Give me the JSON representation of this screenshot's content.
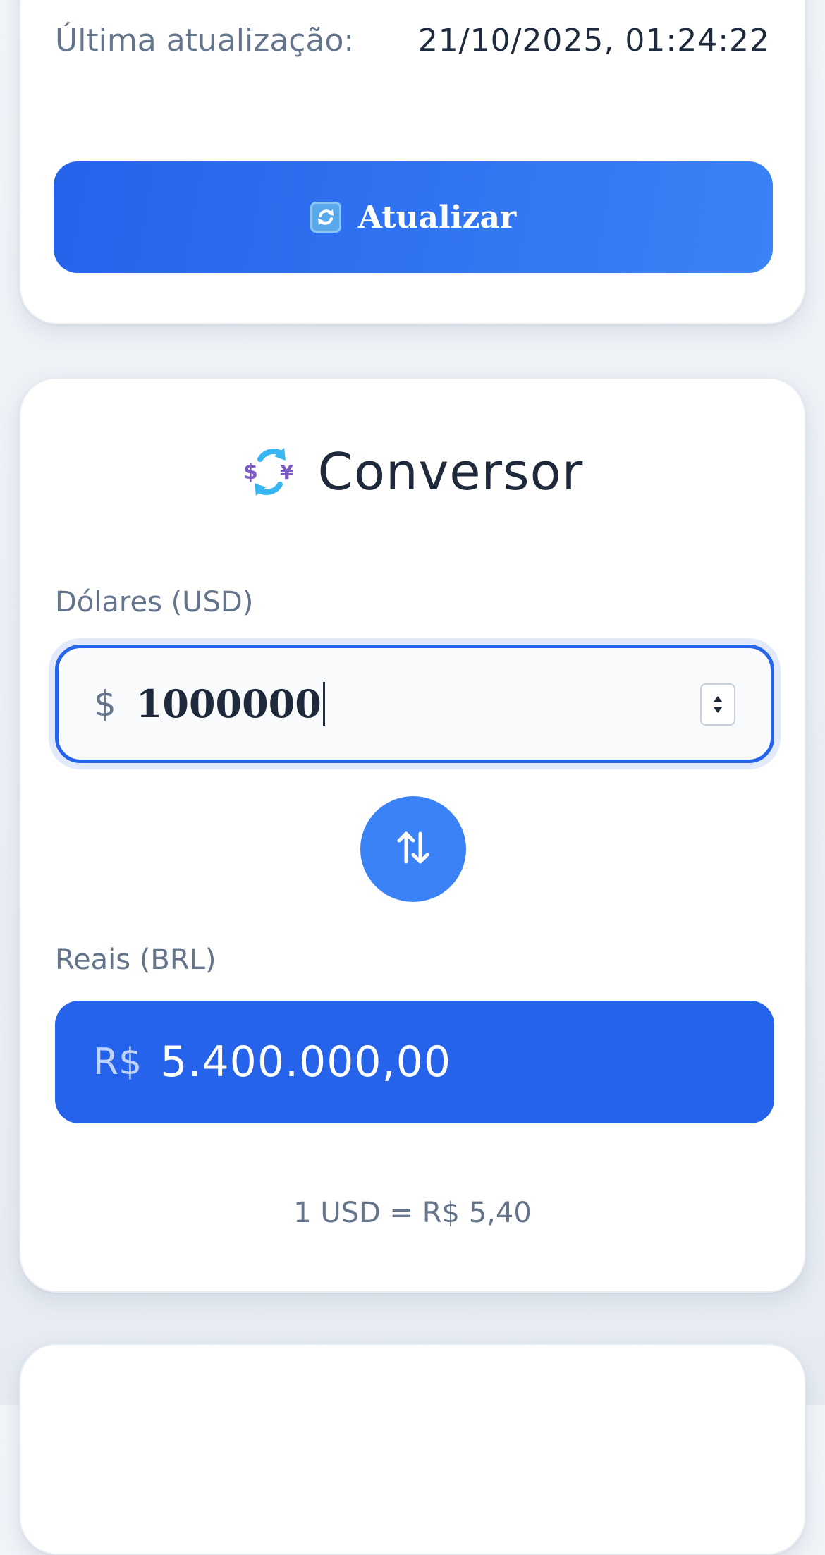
{
  "status": {
    "last_update_label": "Última atualização:",
    "last_update_value": "21/10/2025, 01:24:22"
  },
  "refresh_button": {
    "icon": "refresh-icon",
    "label": "Atualizar"
  },
  "converter": {
    "icon": "currency-exchange-icon",
    "title": "Conversor",
    "usd_label": "Dólares (USD)",
    "usd_prefix": "$",
    "usd_value": "1000000",
    "swap_icon": "swap-vertical-icon",
    "brl_label": "Reais (BRL)",
    "brl_prefix": "R$",
    "brl_value": "5.400.000,00",
    "rate_text": "1 USD = R$ 5,40"
  },
  "colors": {
    "primary": "#2563eb",
    "primary_light": "#3b82f6",
    "text_dark": "#1e293b",
    "text_muted": "#64748b"
  }
}
